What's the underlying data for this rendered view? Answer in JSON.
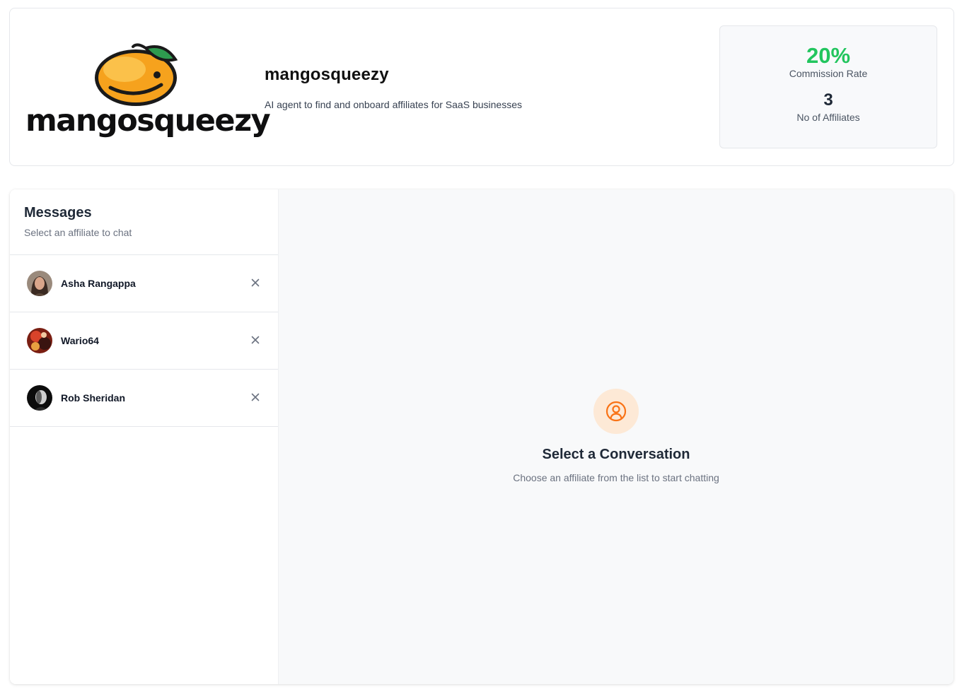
{
  "brand": {
    "logo_text": "mangosqueezy",
    "name": "mangosqueezy",
    "description": "AI agent to find and onboard affiliates for SaaS businesses"
  },
  "stats": {
    "commission_rate": "20%",
    "commission_rate_label": "Commission Rate",
    "affiliate_count": "3",
    "affiliate_count_label": "No of Affiliates"
  },
  "messages": {
    "title": "Messages",
    "subtitle": "Select an affiliate to chat",
    "affiliates": [
      {
        "name": "Asha Rangappa",
        "avatar": "avatar-photo"
      },
      {
        "name": "Wario64",
        "avatar": "avatar-photo"
      },
      {
        "name": "Rob Sheridan",
        "avatar": "avatar-photo"
      }
    ]
  },
  "empty_state": {
    "icon": "user-circle-icon",
    "title": "Select a Conversation",
    "subtitle": "Choose an affiliate from the list to start chatting"
  },
  "colors": {
    "accent_green": "#22c55e",
    "icon_orange": "#f97316",
    "icon_bg": "#fde9d6"
  }
}
